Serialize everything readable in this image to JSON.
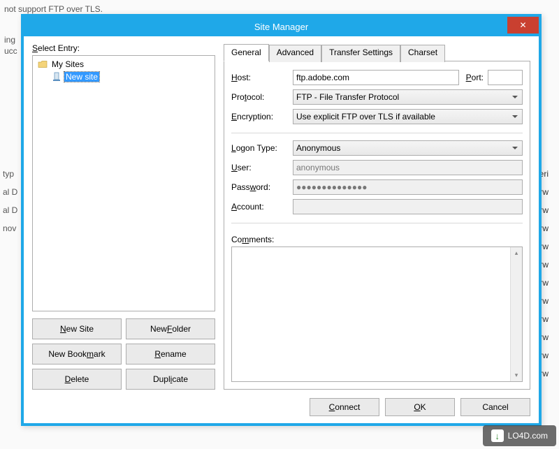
{
  "window": {
    "title": "Site Manager",
    "close_symbol": "✕"
  },
  "left": {
    "label_html": "<span class='underline-char'>S</span>elect Entry:",
    "tree": {
      "root": "My Sites",
      "selected": "New site"
    },
    "buttons": {
      "new_site_html": "<span class='underline-char'>N</span>ew Site",
      "new_folder_html": "New <span class='underline-char'>F</span>older",
      "new_bookmark_html": "New Book<span class='underline-char'>m</span>ark",
      "rename_html": "<span class='underline-char'>R</span>ename",
      "delete_html": "<span class='underline-char'>D</span>elete",
      "duplicate_html": "Dupl<span class='underline-char'>i</span>cate"
    }
  },
  "tabs": {
    "general": "General",
    "advanced": "Advanced",
    "transfer": "Transfer Settings",
    "charset": "Charset"
  },
  "form": {
    "host_label_html": "<span class='underline-char'>H</span>ost:",
    "host_value": "ftp.adobe.com",
    "port_label_html": "<span class='underline-char'>P</span>ort:",
    "port_value": "",
    "protocol_label_html": "Pro<span class='underline-char'>t</span>ocol:",
    "protocol_value": "FTP - File Transfer Protocol",
    "encryption_label_html": "<span class='underline-char'>E</span>ncryption:",
    "encryption_value": "Use explicit FTP over TLS if available",
    "logon_label_html": "<span class='underline-char'>L</span>ogon Type:",
    "logon_value": "Anonymous",
    "user_label_html": "<span class='underline-char'>U</span>ser:",
    "user_value": "anonymous",
    "password_label_html": "Pass<span class='underline-char'>w</span>ord:",
    "password_value": "●●●●●●●●●●●●●●",
    "account_label_html": "<span class='underline-char'>A</span>ccount:",
    "account_value": "",
    "comments_label_html": "Co<span class='underline-char'>m</span>ments:",
    "comments_value": ""
  },
  "bottom": {
    "connect_html": "<span class='underline-char'>C</span>onnect",
    "ok_html": "<span class='underline-char'>O</span>K",
    "cancel": "Cancel"
  },
  "watermark": "LO4D.com",
  "bg": {
    "line1": "not support FTP over TLS.",
    "line2_a": "ing",
    "line2_b": "ucc",
    "col1": "typ",
    "col2a": "al D",
    "col2b": "al D",
    "col3": "nov",
    "perm": "Peri",
    "drw": "drw"
  }
}
